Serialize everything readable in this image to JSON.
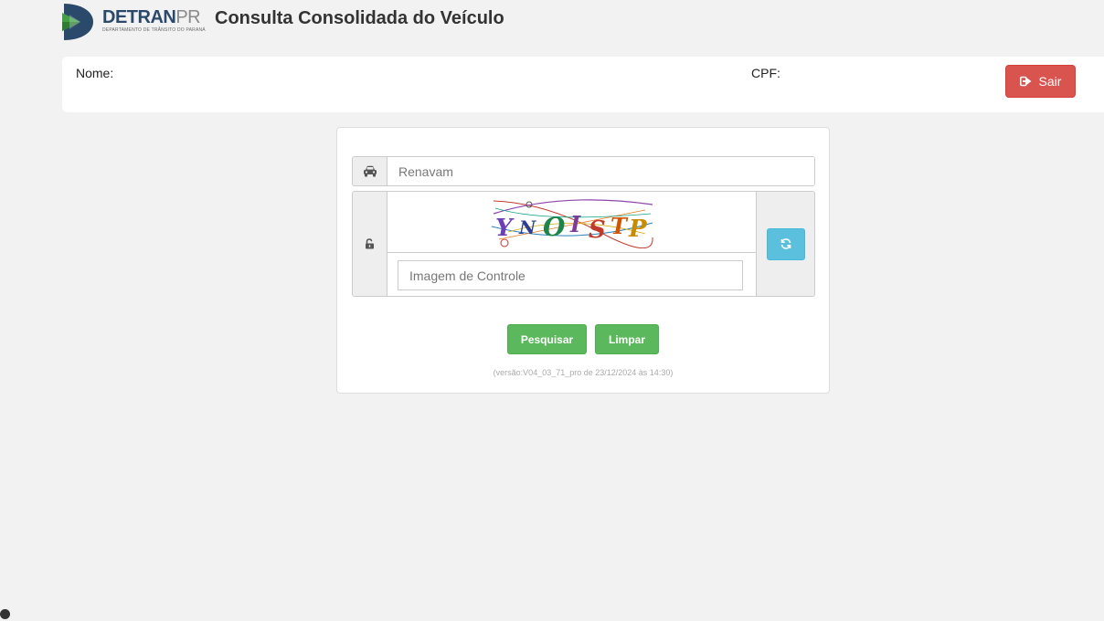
{
  "header": {
    "logo": {
      "brand_primary": "DETRAN",
      "brand_secondary": "PR",
      "subtitle": "DEPARTAMENTO DE TRÂNSITO DO PARANÁ"
    },
    "title": "Consulta Consolidada do Veículo"
  },
  "user_panel": {
    "name_label": "Nome:",
    "cpf_label": "CPF:",
    "logout_label": "Sair",
    "logout_icon": "sign-out-icon"
  },
  "form": {
    "renavam": {
      "placeholder": "Renavam",
      "value": "",
      "icon": "car-icon"
    },
    "captcha": {
      "text": "YNOISTP",
      "placeholder": "Imagem de Controle",
      "value": "",
      "lock_icon": "unlock-icon",
      "refresh_icon": "refresh-icon"
    },
    "search_label": "Pesquisar",
    "clear_label": "Limpar",
    "version": "(versão:V04_03_71_pro de 23/12/2024 às 14:30)"
  },
  "colors": {
    "background": "#f2f2f2",
    "danger": "#d9534f",
    "success": "#5cb85c",
    "info": "#5bc0de",
    "brand": "#2b4a6b"
  }
}
